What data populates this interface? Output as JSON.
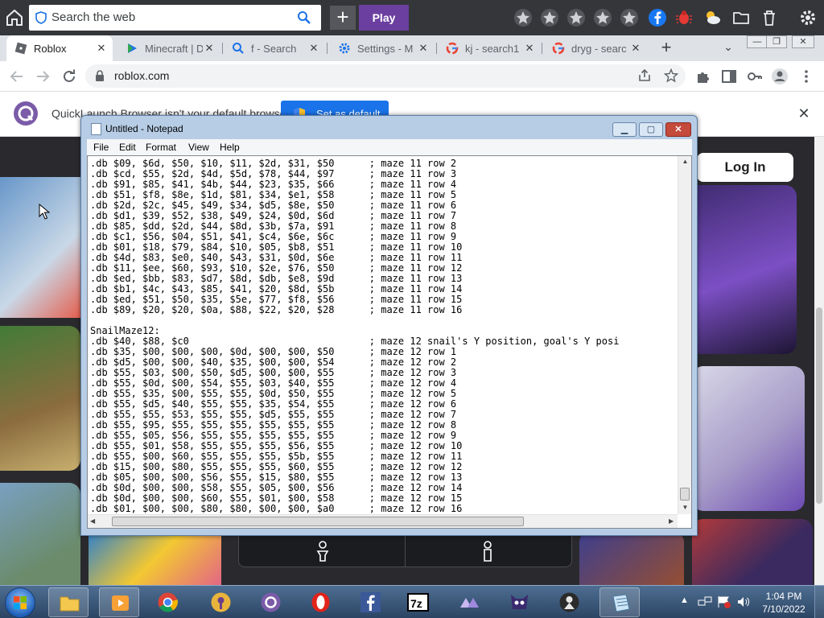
{
  "browser": {
    "search_placeholder": "Search the web",
    "play_label": "Play",
    "tabs": [
      {
        "label": "Roblox",
        "active": true
      },
      {
        "label": "Minecraft | D",
        "active": false
      },
      {
        "label": "f - Search",
        "active": false
      },
      {
        "label": "Settings - M",
        "active": false
      },
      {
        "label": "kj - search1",
        "active": false
      },
      {
        "label": "dryg - searc",
        "active": false
      }
    ],
    "url": "roblox.com",
    "infobar": {
      "text": "QuickLaunch Browser isn't your default browser",
      "button": "Set as default"
    }
  },
  "page": {
    "login_label": "Log In"
  },
  "notepad": {
    "title": "Untitled - Notepad",
    "menu": [
      "File",
      "Edit",
      "Format",
      "View",
      "Help"
    ],
    "lines": [
      ".db $09, $6d, $50, $10, $11, $2d, $31, $50      ; maze 11 row 2",
      ".db $cd, $55, $2d, $4d, $5d, $78, $44, $97      ; maze 11 row 3",
      ".db $91, $85, $41, $4b, $44, $23, $35, $66      ; maze 11 row 4",
      ".db $51, $f8, $8e, $1d, $81, $34, $e1, $58      ; maze 11 row 5",
      ".db $2d, $2c, $45, $49, $34, $d5, $8e, $50      ; maze 11 row 6",
      ".db $d1, $39, $52, $38, $49, $24, $0d, $6d      ; maze 11 row 7",
      ".db $85, $dd, $2d, $44, $8d, $3b, $7a, $91      ; maze 11 row 8",
      ".db $c1, $56, $04, $51, $41, $c4, $6e, $6c      ; maze 11 row 9",
      ".db $01, $18, $79, $84, $10, $05, $b8, $51      ; maze 11 row 10",
      ".db $4d, $83, $e0, $40, $43, $31, $0d, $6e      ; maze 11 row 11",
      ".db $11, $ee, $60, $93, $10, $2e, $76, $50      ; maze 11 row 12",
      ".db $ed, $bb, $83, $d7, $8d, $db, $e8, $9d      ; maze 11 row 13",
      ".db $b1, $4c, $43, $85, $41, $20, $8d, $5b      ; maze 11 row 14",
      ".db $ed, $51, $50, $35, $5e, $77, $f8, $56      ; maze 11 row 15",
      ".db $89, $20, $20, $0a, $88, $22, $20, $28      ; maze 11 row 16",
      "",
      "SnailMaze12:",
      ".db $40, $88, $c0                               ; maze 12 snail's Y position, goal's Y posi",
      ".db $35, $00, $00, $00, $0d, $00, $00, $50      ; maze 12 row 1",
      ".db $d5, $00, $00, $40, $35, $00, $00, $54      ; maze 12 row 2",
      ".db $55, $03, $00, $50, $d5, $00, $00, $55      ; maze 12 row 3",
      ".db $55, $0d, $00, $54, $55, $03, $40, $55      ; maze 12 row 4",
      ".db $55, $35, $00, $55, $55, $0d, $50, $55      ; maze 12 row 5",
      ".db $55, $d5, $40, $55, $55, $35, $54, $55      ; maze 12 row 6",
      ".db $55, $55, $53, $55, $55, $d5, $55, $55      ; maze 12 row 7",
      ".db $55, $95, $55, $55, $55, $55, $55, $55      ; maze 12 row 8",
      ".db $55, $05, $56, $55, $55, $55, $55, $55      ; maze 12 row 9",
      ".db $55, $01, $58, $55, $55, $55, $56, $55      ; maze 12 row 10",
      ".db $55, $00, $60, $55, $55, $55, $5b, $55      ; maze 12 row 11",
      ".db $15, $00, $80, $55, $55, $55, $60, $55      ; maze 12 row 12",
      ".db $05, $00, $00, $56, $55, $15, $80, $55      ; maze 12 row 13",
      ".db $0d, $00, $00, $58, $55, $05, $00, $56      ; maze 12 row 14",
      ".db $0d, $00, $00, $60, $55, $01, $00, $58      ; maze 12 row 15",
      ".db $01, $00, $00, $80, $80, $00, $00, $a0      ; maze 12 row 16"
    ]
  },
  "taskbar": {
    "clock_time": "1:04 PM",
    "clock_date": "7/10/2022"
  },
  "colors": {
    "play_purple": "#6b3fa0",
    "set_default_blue": "#1a73e8"
  }
}
